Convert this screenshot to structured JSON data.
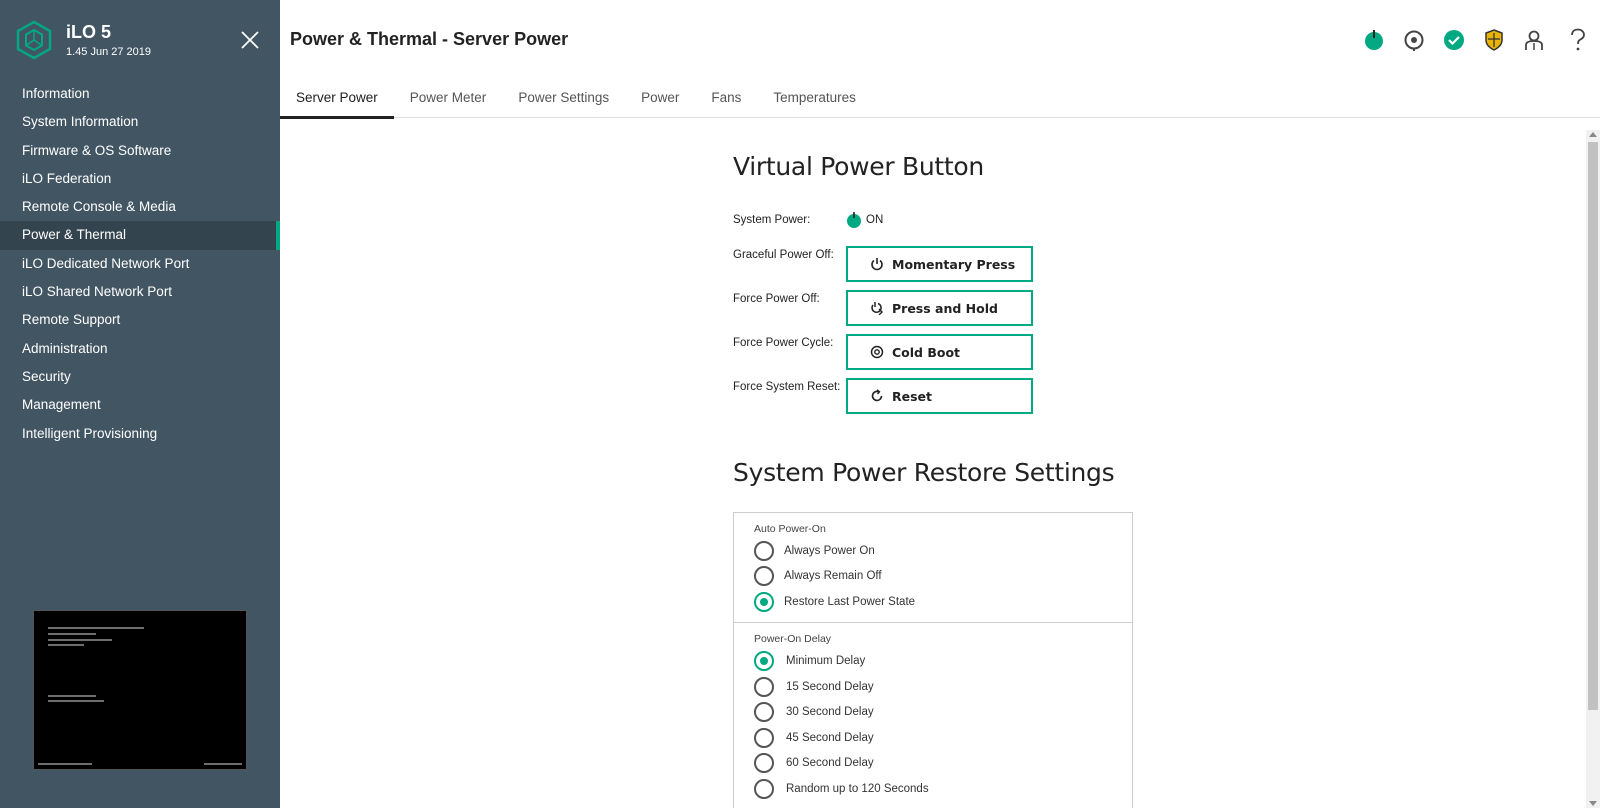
{
  "brand": {
    "title": "iLO 5",
    "version": "1.45 Jun 27 2019"
  },
  "page_title": "Power & Thermal - Server Power",
  "nav": [
    {
      "label": "Information"
    },
    {
      "label": "System Information"
    },
    {
      "label": "Firmware & OS Software"
    },
    {
      "label": "iLO Federation"
    },
    {
      "label": "Remote Console & Media"
    },
    {
      "label": "Power & Thermal",
      "active": true
    },
    {
      "label": "iLO Dedicated Network Port"
    },
    {
      "label": "iLO Shared Network Port"
    },
    {
      "label": "Remote Support"
    },
    {
      "label": "Administration"
    },
    {
      "label": "Security"
    },
    {
      "label": "Management"
    },
    {
      "label": "Intelligent Provisioning"
    }
  ],
  "header_icons": [
    "power-status-icon",
    "locator-icon",
    "health-ok-icon",
    "security-shield-icon",
    "user-icon",
    "help-icon"
  ],
  "tabs": [
    {
      "label": "Server Power",
      "active": true
    },
    {
      "label": "Power Meter"
    },
    {
      "label": "Power Settings"
    },
    {
      "label": "Power"
    },
    {
      "label": "Fans"
    },
    {
      "label": "Temperatures"
    }
  ],
  "virtual_power": {
    "title": "Virtual Power Button",
    "system_power_label": "System Power:",
    "system_power_value": "ON",
    "actions": [
      {
        "label": "Graceful Power Off:",
        "button": "Momentary Press",
        "icon": "power-icon"
      },
      {
        "label": "Force Power Off:",
        "button": "Press and Hold",
        "icon": "press-hold-icon"
      },
      {
        "label": "Force Power Cycle:",
        "button": "Cold Boot",
        "icon": "cold-boot-icon"
      },
      {
        "label": "Force System Reset:",
        "button": "Reset",
        "icon": "reset-icon"
      }
    ]
  },
  "restore": {
    "title": "System Power Restore Settings",
    "auto_power_on": {
      "label": "Auto Power-On",
      "options": [
        "Always Power On",
        "Always Remain Off",
        "Restore Last Power State"
      ],
      "selected": "Restore Last Power State"
    },
    "power_on_delay": {
      "label": "Power-On Delay",
      "options": [
        "Minimum Delay",
        "15 Second Delay",
        "30 Second Delay",
        "45 Second Delay",
        "60 Second Delay",
        "Random up to 120 Seconds"
      ],
      "selected": "Minimum Delay"
    }
  },
  "colors": {
    "accent": "#01a982",
    "sidebar": "#425563",
    "shield": "#e8b400"
  }
}
